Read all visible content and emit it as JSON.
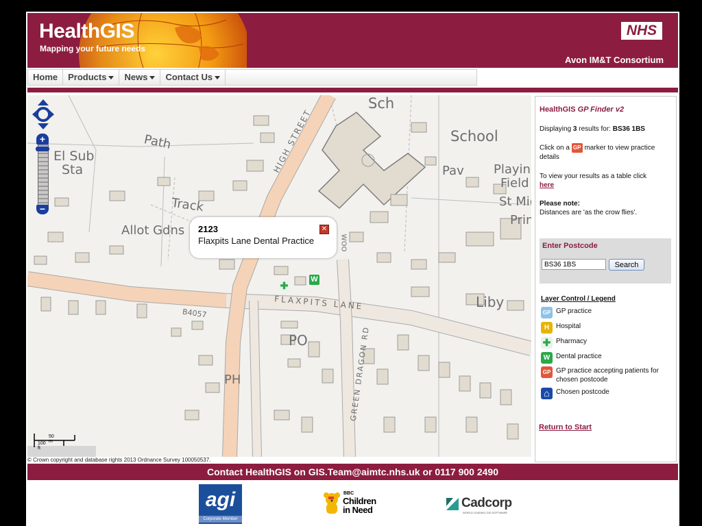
{
  "header": {
    "brand_title": "HealthGIS",
    "brand_tagline": "Mapping your future needs",
    "nhs_logo": "NHS",
    "consortium": "Avon IM&T Consortium"
  },
  "nav": {
    "items": [
      {
        "label": "Home",
        "has_dropdown": false
      },
      {
        "label": "Products",
        "has_dropdown": true
      },
      {
        "label": "News",
        "has_dropdown": true
      },
      {
        "label": "Contact Us",
        "has_dropdown": true
      }
    ]
  },
  "map": {
    "labels": {
      "sch": "Sch",
      "school": "School",
      "el_sub_sta": "El Sub",
      "sta": "Sta",
      "path": "Path",
      "high_street": "HIGH STREET",
      "pav": "Pav",
      "playing": "Playinc",
      "field": "Field",
      "st_mi": "St Mic",
      "prin": "Prin",
      "track": "Track",
      "allot": "Allot Gdns",
      "flaxpits": "FLAXPITS LANE",
      "b4057": "B4057",
      "liby": "Liby",
      "po": "PO",
      "ph": "PH",
      "green_dragon": "GREEN DRAGON RD",
      "wood": "WOO"
    },
    "popup": {
      "number": "2123",
      "name": "Flaxpits Lane Dental Practice",
      "close_glyph": "✕"
    },
    "scale": {
      "metric": "50 m",
      "imperial": "100 ft"
    },
    "copyright": "© Crown copyright and database rights 2013 Ordnance Survey 100050537.",
    "zoom": {
      "in": "+",
      "out": "−"
    }
  },
  "sidebar": {
    "title_brand": "HealthGIS",
    "title_product": "GP Finder v2",
    "results_prefix": "Displaying",
    "results_count": "3",
    "results_mid": "results for:",
    "results_postcode": "BS36 1BS",
    "click_prefix": "Click on a",
    "click_suffix": "marker to view practice details",
    "table_text": "To view your results as a table click",
    "table_link": "here",
    "note_title": "Please note:",
    "note_text": "Distances are 'as the crow flies'.",
    "postcode_title": "Enter Postcode",
    "postcode_value": "BS36 1BS",
    "search_label": "Search",
    "legend_title": "Layer Control / Legend",
    "legend": [
      {
        "label": "GP practice",
        "glyph": "GP",
        "color": "#8ec2e8"
      },
      {
        "label": "Hospital",
        "glyph": "H",
        "color": "#e8b400"
      },
      {
        "label": "Pharmacy",
        "glyph": "✚",
        "color": "#2aa84a"
      },
      {
        "label": "Dental practice",
        "glyph": "W",
        "color": "#2aa84a"
      },
      {
        "label": "GP practice accepting patients for chosen postcode",
        "glyph": "GP",
        "color": "#e2563a"
      },
      {
        "label": "Chosen postcode",
        "glyph": "⌂",
        "color": "#1a4aa8"
      }
    ],
    "return_link": "Return to Start"
  },
  "footer": {
    "contact": "Contact HealthGIS on GIS.Team@aimtc.nhs.uk or 0117 900 2490",
    "agi_logo": "agi",
    "agi_sub": "Corporate Member",
    "cin_bbc": "BBC",
    "cin_logo_line1": "Children",
    "cin_logo_line2": "in Need",
    "cadcorp_logo": "Cadcorp",
    "cadcorp_sub": "WORLD LEADING GIS SOFTWARE"
  },
  "colors": {
    "brand": "#8c1d40",
    "nav_text": "#444444",
    "map_bg": "#f2f1ee",
    "road": "#f5d3b8"
  },
  "icons": {
    "globe": "globe-graphic",
    "pan": "pan-arrows-icon",
    "close": "close-icon",
    "pharmacy": "pharmacy-icon",
    "dental": "dental-icon",
    "gp_badge": "gp-marker-icon"
  }
}
